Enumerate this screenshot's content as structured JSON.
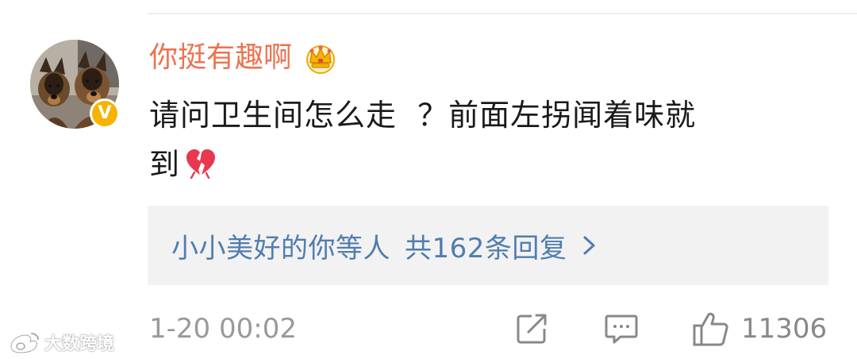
{
  "comment": {
    "username": "你挺有趣啊",
    "text_lines": [
      "请问卫生间怎么走  ？前面左拐闻着味就",
      "到"
    ],
    "timestamp": "1-20 00:02",
    "like_count": "11306",
    "badges": {
      "vip": "crown-icon",
      "verified": "verified-v-icon"
    },
    "verified_mark": "V",
    "emoji": "broken-heart-icon"
  },
  "replies": {
    "users": "小小美好的你等人",
    "count_text": "共162条回复"
  },
  "watermark": {
    "text": "大数跨境",
    "logo": "weibo-logo-icon"
  },
  "colors": {
    "username": "#eb7350",
    "link": "#507daf",
    "muted": "#999999",
    "reply_bg": "#f2f2f2",
    "verified": "#f6b300"
  }
}
